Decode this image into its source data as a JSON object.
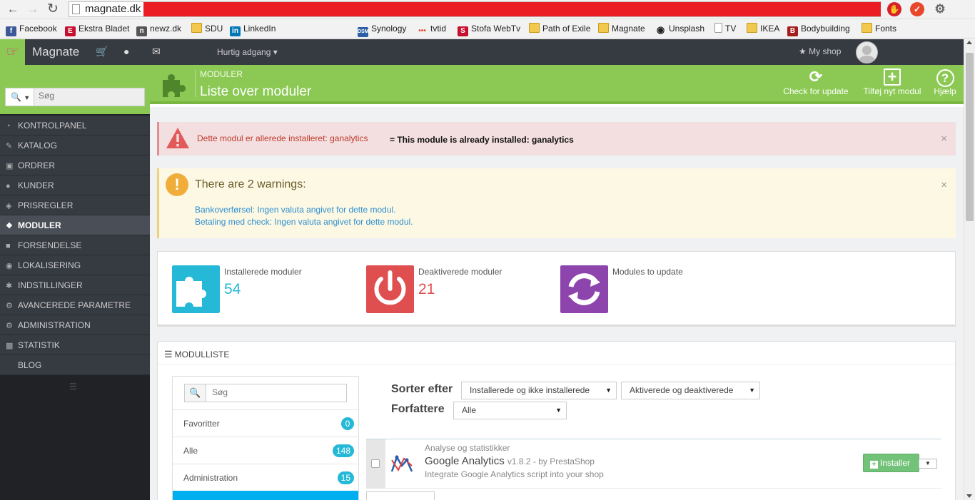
{
  "browser": {
    "url": "magnate.dk",
    "bookmarks": [
      "Facebook",
      "Ekstra Bladet",
      "newz.dk",
      "SDU",
      "LinkedIn",
      "Synology",
      "tvtid",
      "Stofa WebTv",
      "Path of Exile",
      "Magnate",
      "Unsplash",
      "TV",
      "IKEA",
      "Bodybuilding",
      "Fonts"
    ]
  },
  "header": {
    "brand": "Magnate",
    "quick_access": "Hurtig adgang",
    "my_shop": "My shop"
  },
  "sidebar": {
    "search_placeholder": "Søg",
    "items": [
      {
        "label": "KONTROLPANEL",
        "icon": "dashboard-icon"
      },
      {
        "label": "KATALOG",
        "icon": "book-icon"
      },
      {
        "label": "ORDRER",
        "icon": "credit-card-icon"
      },
      {
        "label": "KUNDER",
        "icon": "users-icon"
      },
      {
        "label": "PRISREGLER",
        "icon": "tags-icon"
      },
      {
        "label": "MODULER",
        "icon": "puzzle-icon"
      },
      {
        "label": "FORSENDELSE",
        "icon": "truck-icon"
      },
      {
        "label": "LOKALISERING",
        "icon": "globe-icon"
      },
      {
        "label": "INDSTILLINGER",
        "icon": "wrench-icon"
      },
      {
        "label": "AVANCEREDE PARAMETRE",
        "icon": "cogs-icon"
      },
      {
        "label": "ADMINISTRATION",
        "icon": "cog-icon"
      },
      {
        "label": "STATISTIK",
        "icon": "bar-chart-icon"
      },
      {
        "label": "BLOG",
        "icon": ""
      }
    ]
  },
  "page_header": {
    "breadcrumb": "MODULER",
    "title": "Liste over moduler",
    "toolbar": {
      "check_update": "Check for update",
      "add_module": "Tilføj nyt modul",
      "help": "Hjælp"
    }
  },
  "alerts": {
    "error": "Dette modul er allerede installeret: ganalytics",
    "error_translation": "= This module is already installed: ganalytics",
    "warning_title": "There are 2 warnings:",
    "warnings": [
      "Bankoverførsel: Ingen valuta angivet for dette modul.",
      "Betaling med check: Ingen valuta angivet for dette modul."
    ],
    "close_symbol": "×"
  },
  "stats": {
    "installed_label": "Installerede moduler",
    "installed_value": "54",
    "disabled_label": "Deaktiverede moduler",
    "disabled_value": "21",
    "update_label": "Modules to update",
    "colors": {
      "installed": "#25b9d7",
      "disabled": "#e04f4f",
      "update": "#8e44ad"
    }
  },
  "module_list": {
    "heading": "MODULLISTE",
    "search_placeholder": "Søg",
    "categories": [
      {
        "label": "Favoritter",
        "count": "0"
      },
      {
        "label": "Alle",
        "count": "148"
      },
      {
        "label": "Administration",
        "count": "15"
      }
    ],
    "sort_label": "Sorter efter",
    "sort_value": "Installerede og ikke installerede",
    "status_value": "Aktiverede og deaktiverede",
    "author_label": "Forfattere",
    "author_value": "Alle",
    "module": {
      "category": "Analyse og statistikker",
      "name": "Google Analytics",
      "version": "v1.8.2 - by PrestaShop",
      "description": "Integrate Google Analytics script into your shop",
      "install_label": "Installer"
    }
  },
  "colors": {
    "accent_green": "#8bc954",
    "sidebar_dark": "#363a41",
    "link_blue": "#2f8fd1"
  }
}
